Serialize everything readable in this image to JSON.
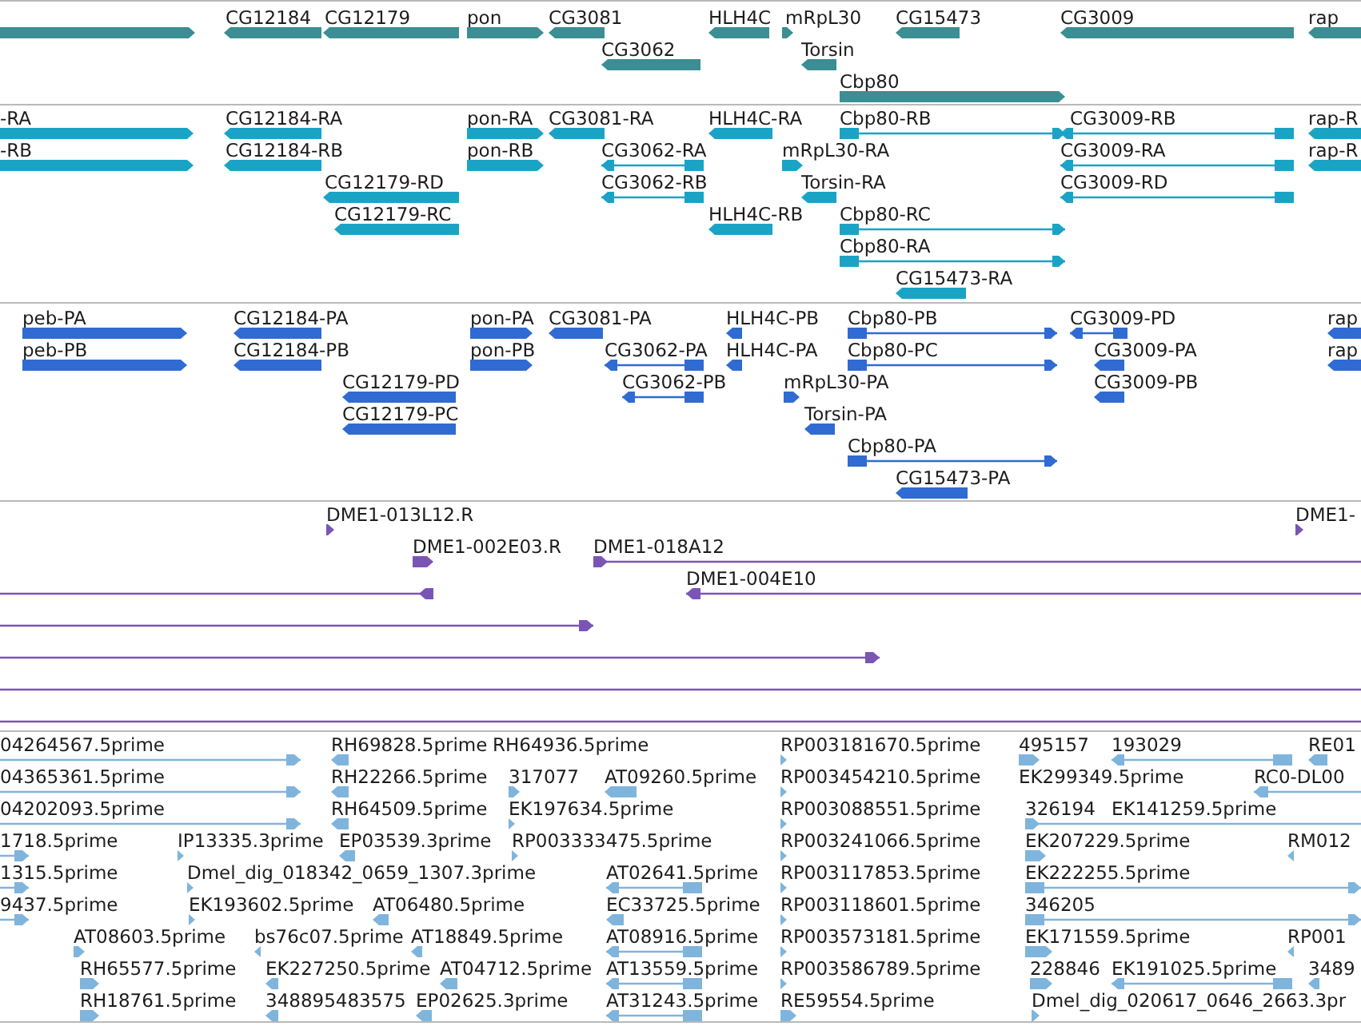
{
  "tracks": [
    {
      "color": "#3b8e93",
      "features": [
        {
          "reverse": false
        },
        {
          "label": "CG12184",
          "reverse": true
        },
        {
          "label": "CG12179",
          "reverse": true
        },
        {
          "label": "pon",
          "reverse": false
        },
        {
          "label": "CG3081",
          "reverse": true
        },
        {
          "label": "HLH4C",
          "reverse": true
        },
        {
          "label": "mRpL30",
          "reverse": false
        },
        {
          "label": "CG15473",
          "reverse": true
        },
        {
          "label": "CG3009",
          "reverse": true
        },
        {
          "label": "rap",
          "reverse": true
        },
        {
          "label": "CG3062",
          "reverse": true
        },
        {
          "label": "Torsin",
          "reverse": true
        },
        {
          "label": "Cbp80",
          "reverse": false
        }
      ]
    },
    {
      "color": "#1ba3c6",
      "features": [
        {
          "label": "-RA",
          "reverse": false
        },
        {
          "label": "CG12184-RA",
          "reverse": true
        },
        {
          "label": "pon-RA",
          "reverse": false
        },
        {
          "label": "CG3081-RA",
          "reverse": true
        },
        {
          "label": "HLH4C-RA",
          "reverse": true
        },
        {
          "label": "Cbp80-RB",
          "reverse": false
        },
        {
          "label": "CG3009-RB",
          "reverse": true
        },
        {
          "label": "rap-R",
          "reverse": true
        },
        {
          "label": "-RB",
          "reverse": false
        },
        {
          "label": "CG12184-RB",
          "reverse": true
        },
        {
          "label": "pon-RB",
          "reverse": false
        },
        {
          "label": "CG3062-RA",
          "reverse": true
        },
        {
          "label": "mRpL30-RA",
          "reverse": false
        },
        {
          "label": "CG3009-RA",
          "reverse": true
        },
        {
          "label": "rap-R",
          "reverse": true
        },
        {
          "label": "CG12179-RD",
          "reverse": true
        },
        {
          "label": "CG3062-RB",
          "reverse": true
        },
        {
          "label": "Torsin-RA",
          "reverse": true
        },
        {
          "label": "CG3009-RD",
          "reverse": true
        },
        {
          "label": "CG12179-RC",
          "reverse": true
        },
        {
          "label": "HLH4C-RB",
          "reverse": true
        },
        {
          "label": "Cbp80-RC",
          "reverse": false
        },
        {
          "label": "Cbp80-RA",
          "reverse": false
        },
        {
          "label": "CG15473-RA",
          "reverse": true
        }
      ]
    },
    {
      "color": "#2f6bd3",
      "features": [
        {
          "label": "peb-PA",
          "reverse": false
        },
        {
          "label": "CG12184-PA",
          "reverse": true
        },
        {
          "label": "pon-PA",
          "reverse": false
        },
        {
          "label": "CG3081-PA",
          "reverse": true
        },
        {
          "label": "HLH4C-PB",
          "reverse": true
        },
        {
          "label": "Cbp80-PB",
          "reverse": false
        },
        {
          "label": "CG3009-PD",
          "reverse": true
        },
        {
          "label": "rap",
          "reverse": true
        },
        {
          "label": "peb-PB",
          "reverse": false
        },
        {
          "label": "CG12184-PB",
          "reverse": true
        },
        {
          "label": "pon-PB",
          "reverse": false
        },
        {
          "label": "CG3062-PA",
          "reverse": true
        },
        {
          "label": "HLH4C-PA",
          "reverse": true
        },
        {
          "label": "Cbp80-PC",
          "reverse": false
        },
        {
          "label": "CG3009-PA",
          "reverse": true
        },
        {
          "label": "rap",
          "reverse": true
        },
        {
          "label": "CG12179-PD",
          "reverse": true
        },
        {
          "label": "CG3062-PB",
          "reverse": true
        },
        {
          "label": "mRpL30-PA",
          "reverse": false
        },
        {
          "label": "CG3009-PB",
          "reverse": true
        },
        {
          "label": "CG12179-PC",
          "reverse": true
        },
        {
          "label": "Torsin-PA",
          "reverse": true
        },
        {
          "label": "Cbp80-PA",
          "reverse": false
        },
        {
          "label": "CG15473-PA",
          "reverse": true
        }
      ]
    },
    {
      "color": "#7b55b5",
      "features": [
        {
          "kind": "clone",
          "label": "DME1-013L12.R",
          "reverse": false
        },
        {
          "kind": "clone",
          "label": "DME1-",
          "reverse": false
        },
        {
          "kind": "clone",
          "label": "DME1-002E03.R",
          "reverse": false
        },
        {
          "kind": "clone",
          "label": "DME1-018A12",
          "reverse": false
        },
        {
          "kind": "clone",
          "reverse": true
        },
        {
          "kind": "clone",
          "label": "DME1-004E10",
          "reverse": true
        },
        {
          "kind": "clone",
          "reverse": false
        },
        {
          "kind": "clone",
          "reverse": false
        },
        {
          "kind": "line"
        },
        {
          "kind": "line"
        }
      ]
    },
    {
      "color": "#7fb5dc",
      "features": [
        {
          "label": "04264567.5prime",
          "reverse": false
        },
        {
          "label": "RH69828.5prime",
          "reverse": true
        },
        {
          "label": "RH64936.5prime"
        },
        {
          "label": "RP003181670.5prime",
          "reverse": false
        },
        {
          "label": "495157",
          "reverse": false
        },
        {
          "label": "193029",
          "reverse": true
        },
        {
          "label": "RE01",
          "reverse": true
        },
        {
          "label": "04365361.5prime",
          "reverse": false
        },
        {
          "label": "RH22266.5prime",
          "reverse": true
        },
        {
          "label": "317077",
          "reverse": false
        },
        {
          "label": "AT09260.5prime",
          "reverse": true
        },
        {
          "label": "RP003454210.5prime",
          "reverse": false
        },
        {
          "label": "EK299349.5prime"
        },
        {
          "label": "RC0-DL00",
          "reverse": true
        },
        {
          "label": "04202093.5prime",
          "reverse": false
        },
        {
          "label": "RH64509.5prime",
          "reverse": true
        },
        {
          "label": "EK197634.5prime",
          "reverse": false
        },
        {
          "label": "RP003088551.5prime",
          "reverse": false
        },
        {
          "label": "326194",
          "reverse": false
        },
        {
          "label": "EK141259.5prime"
        },
        {
          "label": "1718.5prime",
          "reverse": false
        },
        {
          "label": "IP13335.3prime",
          "reverse": false
        },
        {
          "label": "EP03539.3prime",
          "reverse": true
        },
        {
          "label": "RP003333475.5prime",
          "reverse": false
        },
        {
          "label": "RP003241066.5prime",
          "reverse": false
        },
        {
          "label": "EK207229.5prime",
          "reverse": false
        },
        {
          "label": "RM012",
          "reverse": true
        },
        {
          "label": "1315.5prime",
          "reverse": false
        },
        {
          "label": "Dmel_dig_018342_0659_1307.3prime",
          "reverse": false
        },
        {
          "label": "AT02641.5prime",
          "reverse": true
        },
        {
          "label": "RP003117853.5prime",
          "reverse": false
        },
        {
          "label": "EK222255.5prime",
          "reverse": false
        },
        {
          "label": "9437.5prime",
          "reverse": false
        },
        {
          "label": "EK193602.5prime",
          "reverse": false
        },
        {
          "label": "AT06480.5prime",
          "reverse": true
        },
        {
          "label": "EC33725.5prime",
          "reverse": true
        },
        {
          "label": "RP003118601.5prime",
          "reverse": false
        },
        {
          "label": "346205",
          "reverse": false
        },
        {
          "label": "AT08603.5prime",
          "reverse": false
        },
        {
          "label": "bs76c07.5prime",
          "reverse": true
        },
        {
          "label": "AT18849.5prime",
          "reverse": true
        },
        {
          "label": "AT08916.5prime",
          "reverse": true
        },
        {
          "label": "RP003573181.5prime",
          "reverse": false
        },
        {
          "label": "EK171559.5prime",
          "reverse": false
        },
        {
          "label": "RP001",
          "reverse": true
        },
        {
          "label": "RH65577.5prime",
          "reverse": false
        },
        {
          "label": "EK227250.5prime",
          "reverse": true
        },
        {
          "label": "AT04712.5prime",
          "reverse": true
        },
        {
          "label": "AT13559.5prime",
          "reverse": true
        },
        {
          "label": "RP003586789.5prime",
          "reverse": false
        },
        {
          "label": "228846",
          "reverse": false
        },
        {
          "label": "EK191025.5prime",
          "reverse": true
        },
        {
          "label": "3489",
          "reverse": true
        },
        {
          "label": "RH18761.5prime",
          "reverse": false
        },
        {
          "label": "348895483575",
          "reverse": true
        },
        {
          "label": "EP02625.3prime",
          "reverse": true
        },
        {
          "label": "AT31243.5prime",
          "reverse": true
        },
        {
          "label": "RE59554.5prime",
          "reverse": false
        },
        {
          "label": "Dmel_dig_020617_0646_2663.3pr",
          "reverse": false
        }
      ]
    }
  ]
}
